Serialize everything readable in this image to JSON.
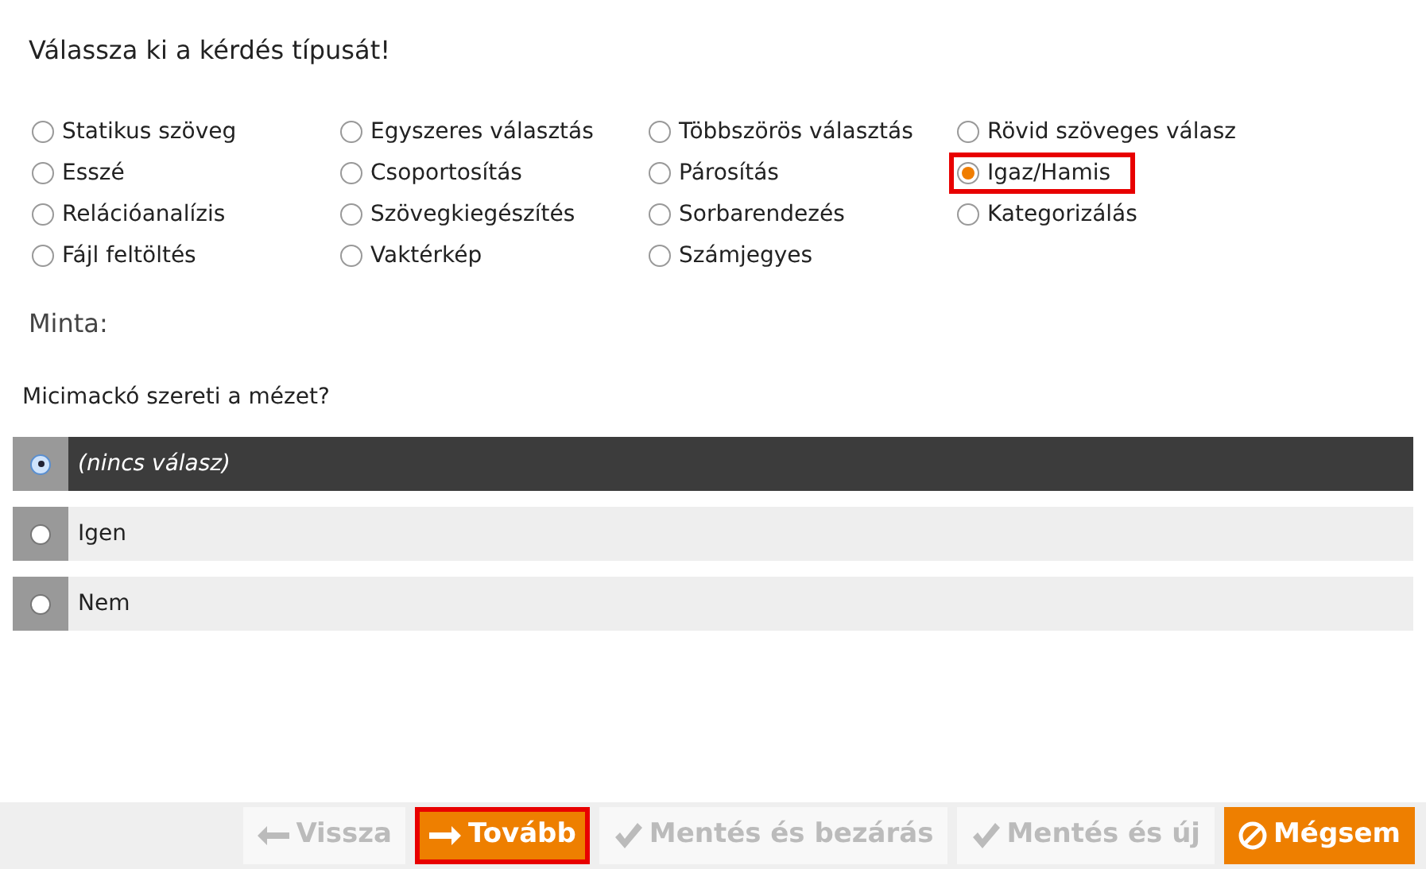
{
  "heading": "Válassza ki a kérdés típusát!",
  "question_types": [
    {
      "label": "Statikus szöveg",
      "selected": false,
      "highlighted": false
    },
    {
      "label": "Egyszeres választás",
      "selected": false,
      "highlighted": false
    },
    {
      "label": "Többszörös választás",
      "selected": false,
      "highlighted": false
    },
    {
      "label": "Rövid szöveges válasz",
      "selected": false,
      "highlighted": false
    },
    {
      "label": "Esszé",
      "selected": false,
      "highlighted": false
    },
    {
      "label": "Csoportosítás",
      "selected": false,
      "highlighted": false
    },
    {
      "label": "Párosítás",
      "selected": false,
      "highlighted": false
    },
    {
      "label": "Igaz/Hamis",
      "selected": true,
      "highlighted": true
    },
    {
      "label": "Relációanalízis",
      "selected": false,
      "highlighted": false
    },
    {
      "label": "Szövegkiegészítés",
      "selected": false,
      "highlighted": false
    },
    {
      "label": "Sorbarendezés",
      "selected": false,
      "highlighted": false
    },
    {
      "label": "Kategorizálás",
      "selected": false,
      "highlighted": false
    },
    {
      "label": "Fájl feltöltés",
      "selected": false,
      "highlighted": false
    },
    {
      "label": "Vaktérkép",
      "selected": false,
      "highlighted": false
    },
    {
      "label": "Számjegyes",
      "selected": false,
      "highlighted": false
    }
  ],
  "sample_heading": "Minta:",
  "sample_question": "Micimackó szereti a mézet?",
  "answers": [
    {
      "label": "(nincs válasz)",
      "selected": true
    },
    {
      "label": "Igen",
      "selected": false
    },
    {
      "label": "Nem",
      "selected": false
    }
  ],
  "buttons": [
    {
      "label": "Vissza",
      "kind": "back",
      "disabled": true,
      "highlighted": false
    },
    {
      "label": "Tovább",
      "kind": "next",
      "disabled": false,
      "highlighted": true
    },
    {
      "label": "Mentés és bezárás",
      "kind": "save",
      "disabled": true,
      "highlighted": false
    },
    {
      "label": "Mentés és új",
      "kind": "save",
      "disabled": true,
      "highlighted": false
    },
    {
      "label": "Mégsem",
      "kind": "cancel",
      "disabled": false,
      "highlighted": false
    }
  ]
}
